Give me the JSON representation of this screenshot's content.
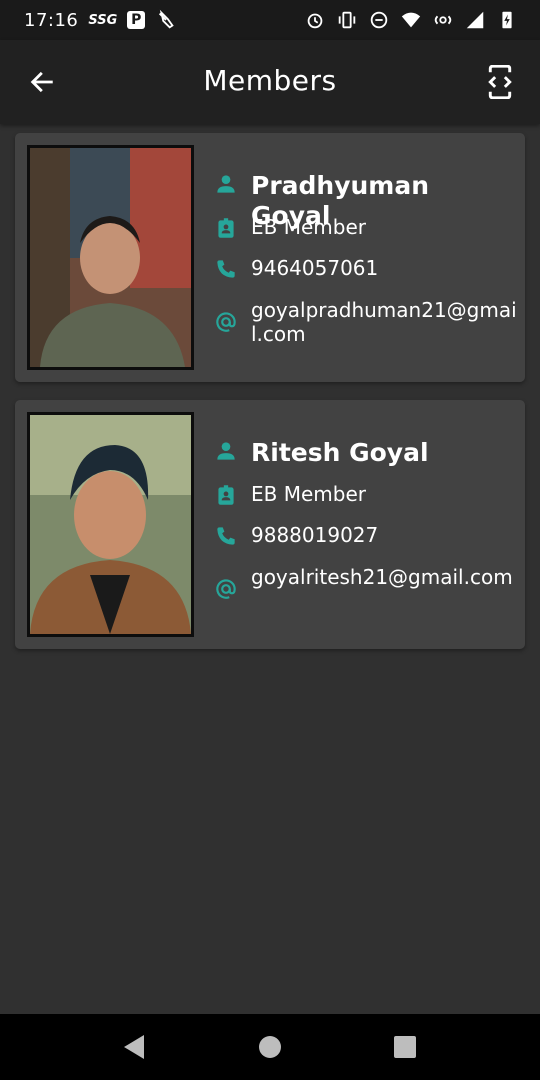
{
  "status_bar": {
    "time": "17:16",
    "carrier_badge": "SSG",
    "p_badge": "P"
  },
  "app_bar": {
    "title": "Members"
  },
  "colors": {
    "accent": "#26a69a",
    "card": "#424242",
    "background": "#303030",
    "app_bar": "#212121"
  },
  "members": [
    {
      "name": "Pradhyuman Goyal",
      "role": "EB Member",
      "phone": "9464057061",
      "email": "goyalpradhuman21@gmail.com"
    },
    {
      "name": "Ritesh Goyal",
      "role": "EB Member",
      "phone": "9888019027",
      "email": "goyalritesh21@gmail.com"
    }
  ],
  "icons": {
    "back": "arrow-left-icon",
    "dev": "developer-mode-icon",
    "person": "person-icon",
    "badge": "badge-icon",
    "phone": "phone-icon",
    "email": "at-sign-icon"
  }
}
